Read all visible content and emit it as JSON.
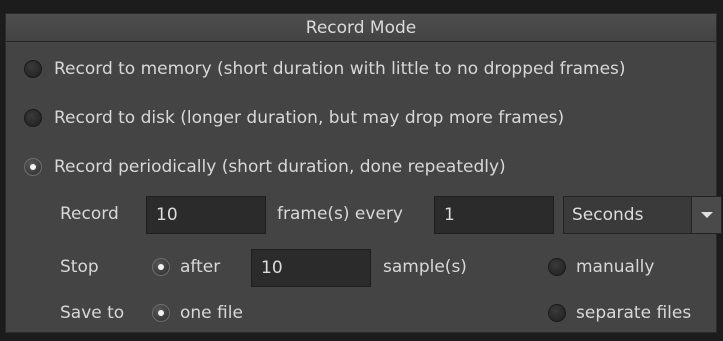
{
  "panel": {
    "title": "Record Mode"
  },
  "modes": [
    {
      "label": "Record to memory (short duration with little to no dropped frames)",
      "selected": false
    },
    {
      "label": "Record to disk (longer duration, but may drop more frames)",
      "selected": false
    },
    {
      "label": "Record periodically (short duration, done repeatedly)",
      "selected": true
    }
  ],
  "periodic": {
    "record_label": "Record",
    "frames_value": "10",
    "frames_every_label": "frame(s) every",
    "interval_value": "1",
    "interval_unit": "Seconds",
    "stop_label": "Stop",
    "stop_after_label": "after",
    "stop_after_selected": true,
    "samples_value": "10",
    "samples_label": "sample(s)",
    "stop_manually_label": "manually",
    "stop_manually_selected": false,
    "save_to_label": "Save to",
    "one_file_label": "one file",
    "one_file_selected": true,
    "separate_files_label": "separate files",
    "separate_files_selected": false
  },
  "colors": {
    "panel_bg": "#444444",
    "field_bg": "#2b2b2b",
    "text": "#d8d8d8"
  }
}
